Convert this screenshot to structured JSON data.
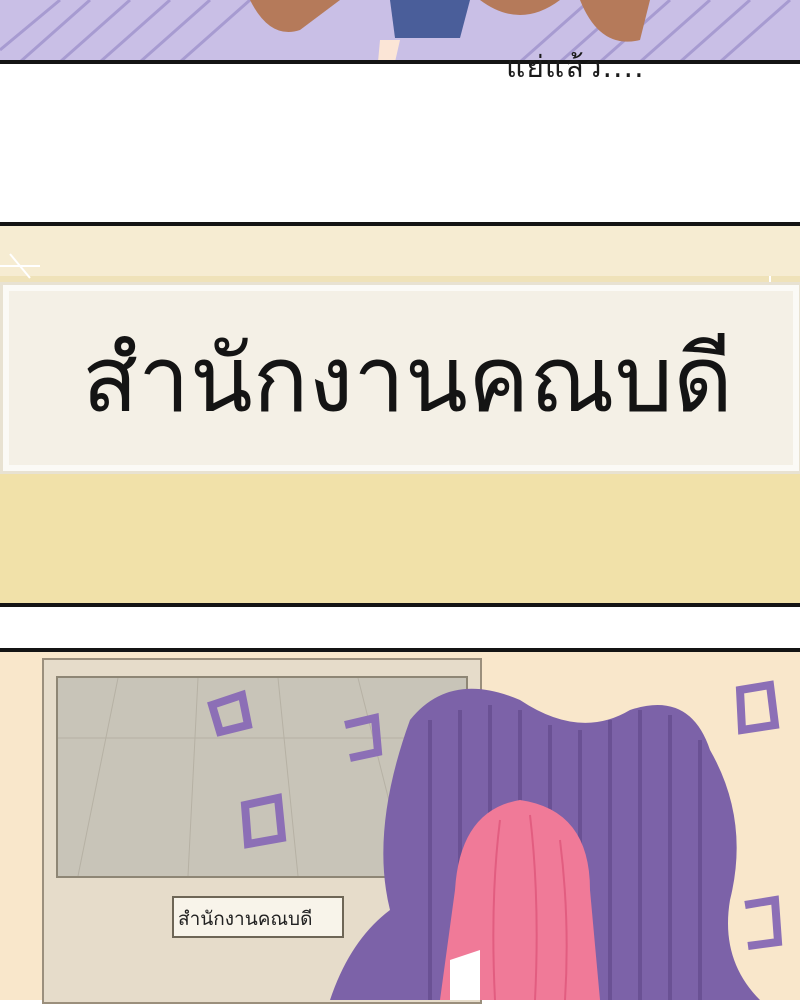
{
  "top_panel": {
    "caption": "แย่แล้ว...."
  },
  "sign_panel": {
    "sign_text": "สำนักงานคณบดี"
  },
  "bottom_panel": {
    "door_label": "สำนักงานคณบดี"
  },
  "colors": {
    "panel_border": "#141414",
    "top_bg": "#c9bfe6",
    "sign_bg": "#efe2b9",
    "aura": "#7c62a8",
    "hair": "#f07a98"
  }
}
